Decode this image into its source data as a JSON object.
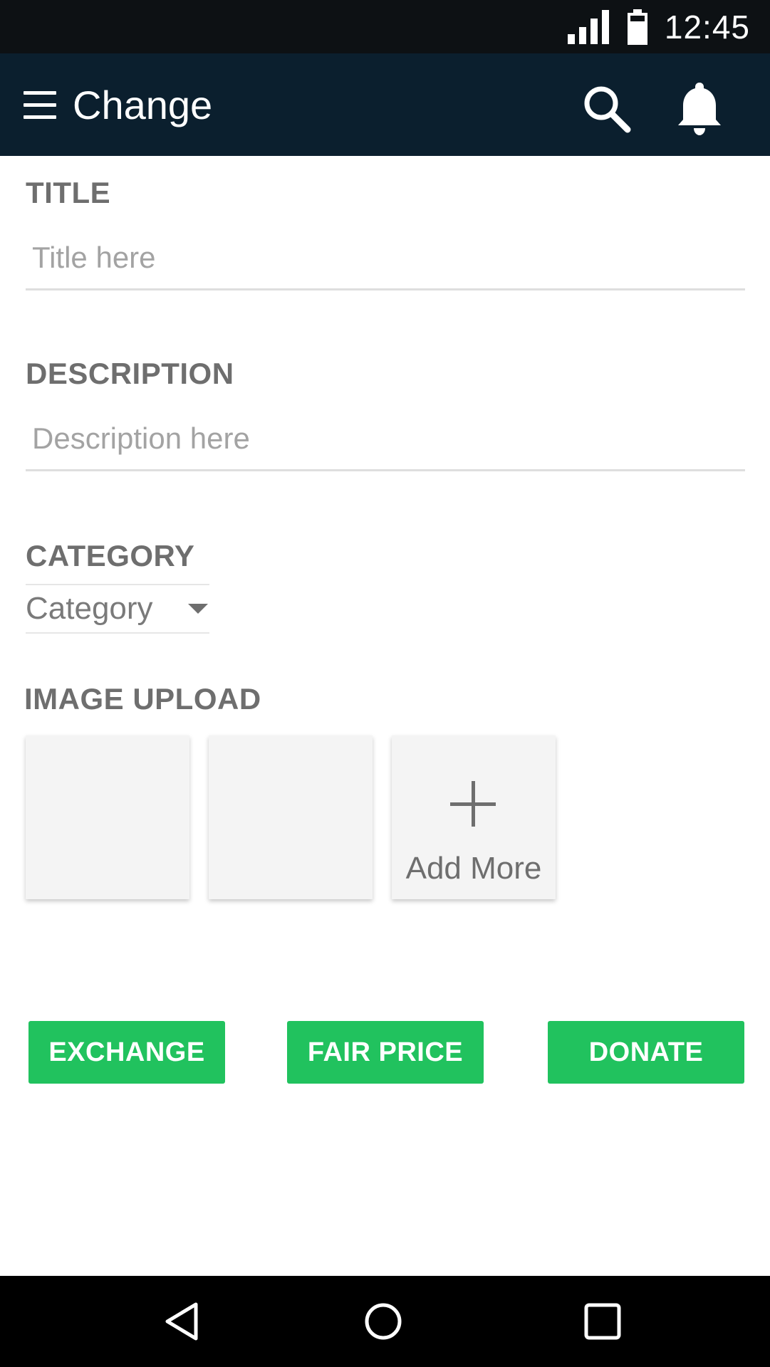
{
  "status_bar": {
    "time": "12:45",
    "icons": [
      "signal-icon",
      "battery-icon"
    ]
  },
  "app_bar": {
    "title": "Change",
    "icons": [
      "menu-icon",
      "search-icon",
      "bell-icon"
    ]
  },
  "form": {
    "title": {
      "label": "TITLE",
      "placeholder": "Title here",
      "value": ""
    },
    "description": {
      "label": "DESCRIPTION",
      "placeholder": "Description here",
      "value": ""
    },
    "category": {
      "label": "CATEGORY",
      "selected": "Category"
    },
    "image_upload": {
      "label": "IMAGE UPLOAD",
      "add_more_label": "Add More"
    }
  },
  "actions": {
    "exchange": "EXCHANGE",
    "fair_price": "FAIR PRICE",
    "donate": "DONATE"
  },
  "colors": {
    "status_bar": "#0d1114",
    "app_bar": "#0b1f2e",
    "accent": "#21c25e",
    "label": "#6e6e6e"
  },
  "nav_bar": {
    "icons": [
      "back-icon",
      "home-icon",
      "recents-icon"
    ]
  }
}
